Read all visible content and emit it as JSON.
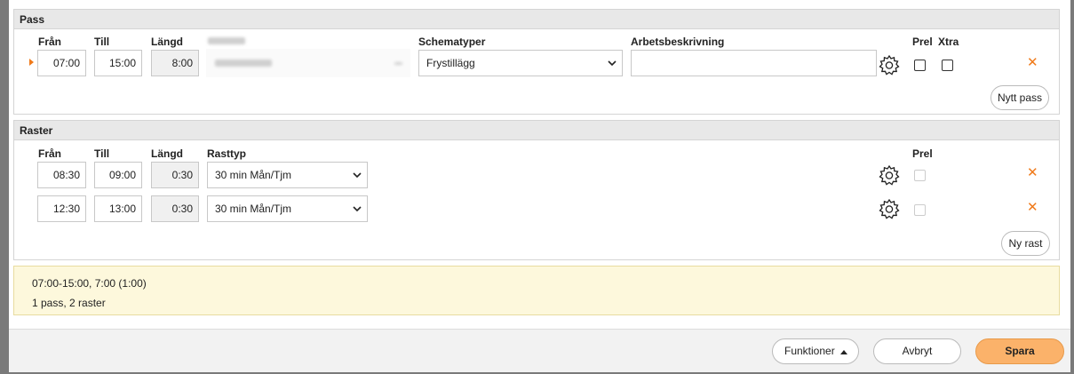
{
  "pass": {
    "title": "Pass",
    "labels": {
      "from": "Från",
      "to": "Till",
      "length": "Längd",
      "schedule_type": "Schematyper",
      "work_description": "Arbetsbeskrivning",
      "prel": "Prel",
      "xtra": "Xtra"
    },
    "row": {
      "from": "07:00",
      "to": "15:00",
      "length": "8:00",
      "schedule_type": "Frystillägg",
      "work_description": ""
    },
    "new_button": "Nytt pass"
  },
  "breaks": {
    "title": "Raster",
    "labels": {
      "from": "Från",
      "to": "Till",
      "length": "Längd",
      "break_type": "Rasttyp",
      "prel": "Prel"
    },
    "rows": [
      {
        "from": "08:30",
        "to": "09:00",
        "length": "0:30",
        "type": "30 min Mån/Tjm"
      },
      {
        "from": "12:30",
        "to": "13:00",
        "length": "0:30",
        "type": "30 min Mån/Tjm"
      }
    ],
    "new_button": "Ny rast"
  },
  "summary": {
    "line1": "07:00-15:00, 7:00 (1:00)",
    "line2": "1 pass, 2 raster"
  },
  "footer": {
    "functions": "Funktioner",
    "cancel": "Avbryt",
    "save": "Spara"
  },
  "colors": {
    "accent": "#f07a1a",
    "save_button": "#fbb26a",
    "summary_bg": "#fdf8dc"
  }
}
